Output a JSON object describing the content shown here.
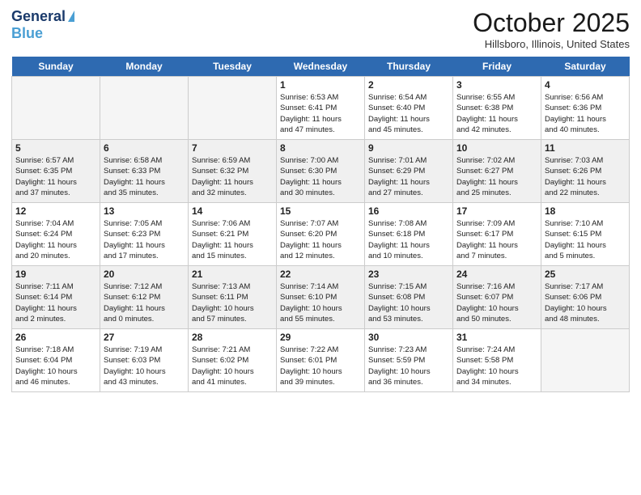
{
  "header": {
    "logo_line1": "General",
    "logo_line2": "Blue",
    "month": "October 2025",
    "location": "Hillsboro, Illinois, United States"
  },
  "days_of_week": [
    "Sunday",
    "Monday",
    "Tuesday",
    "Wednesday",
    "Thursday",
    "Friday",
    "Saturday"
  ],
  "weeks": [
    [
      {
        "day": "",
        "info": ""
      },
      {
        "day": "",
        "info": ""
      },
      {
        "day": "",
        "info": ""
      },
      {
        "day": "1",
        "info": "Sunrise: 6:53 AM\nSunset: 6:41 PM\nDaylight: 11 hours\nand 47 minutes."
      },
      {
        "day": "2",
        "info": "Sunrise: 6:54 AM\nSunset: 6:40 PM\nDaylight: 11 hours\nand 45 minutes."
      },
      {
        "day": "3",
        "info": "Sunrise: 6:55 AM\nSunset: 6:38 PM\nDaylight: 11 hours\nand 42 minutes."
      },
      {
        "day": "4",
        "info": "Sunrise: 6:56 AM\nSunset: 6:36 PM\nDaylight: 11 hours\nand 40 minutes."
      }
    ],
    [
      {
        "day": "5",
        "info": "Sunrise: 6:57 AM\nSunset: 6:35 PM\nDaylight: 11 hours\nand 37 minutes."
      },
      {
        "day": "6",
        "info": "Sunrise: 6:58 AM\nSunset: 6:33 PM\nDaylight: 11 hours\nand 35 minutes."
      },
      {
        "day": "7",
        "info": "Sunrise: 6:59 AM\nSunset: 6:32 PM\nDaylight: 11 hours\nand 32 minutes."
      },
      {
        "day": "8",
        "info": "Sunrise: 7:00 AM\nSunset: 6:30 PM\nDaylight: 11 hours\nand 30 minutes."
      },
      {
        "day": "9",
        "info": "Sunrise: 7:01 AM\nSunset: 6:29 PM\nDaylight: 11 hours\nand 27 minutes."
      },
      {
        "day": "10",
        "info": "Sunrise: 7:02 AM\nSunset: 6:27 PM\nDaylight: 11 hours\nand 25 minutes."
      },
      {
        "day": "11",
        "info": "Sunrise: 7:03 AM\nSunset: 6:26 PM\nDaylight: 11 hours\nand 22 minutes."
      }
    ],
    [
      {
        "day": "12",
        "info": "Sunrise: 7:04 AM\nSunset: 6:24 PM\nDaylight: 11 hours\nand 20 minutes."
      },
      {
        "day": "13",
        "info": "Sunrise: 7:05 AM\nSunset: 6:23 PM\nDaylight: 11 hours\nand 17 minutes."
      },
      {
        "day": "14",
        "info": "Sunrise: 7:06 AM\nSunset: 6:21 PM\nDaylight: 11 hours\nand 15 minutes."
      },
      {
        "day": "15",
        "info": "Sunrise: 7:07 AM\nSunset: 6:20 PM\nDaylight: 11 hours\nand 12 minutes."
      },
      {
        "day": "16",
        "info": "Sunrise: 7:08 AM\nSunset: 6:18 PM\nDaylight: 11 hours\nand 10 minutes."
      },
      {
        "day": "17",
        "info": "Sunrise: 7:09 AM\nSunset: 6:17 PM\nDaylight: 11 hours\nand 7 minutes."
      },
      {
        "day": "18",
        "info": "Sunrise: 7:10 AM\nSunset: 6:15 PM\nDaylight: 11 hours\nand 5 minutes."
      }
    ],
    [
      {
        "day": "19",
        "info": "Sunrise: 7:11 AM\nSunset: 6:14 PM\nDaylight: 11 hours\nand 2 minutes."
      },
      {
        "day": "20",
        "info": "Sunrise: 7:12 AM\nSunset: 6:12 PM\nDaylight: 11 hours\nand 0 minutes."
      },
      {
        "day": "21",
        "info": "Sunrise: 7:13 AM\nSunset: 6:11 PM\nDaylight: 10 hours\nand 57 minutes."
      },
      {
        "day": "22",
        "info": "Sunrise: 7:14 AM\nSunset: 6:10 PM\nDaylight: 10 hours\nand 55 minutes."
      },
      {
        "day": "23",
        "info": "Sunrise: 7:15 AM\nSunset: 6:08 PM\nDaylight: 10 hours\nand 53 minutes."
      },
      {
        "day": "24",
        "info": "Sunrise: 7:16 AM\nSunset: 6:07 PM\nDaylight: 10 hours\nand 50 minutes."
      },
      {
        "day": "25",
        "info": "Sunrise: 7:17 AM\nSunset: 6:06 PM\nDaylight: 10 hours\nand 48 minutes."
      }
    ],
    [
      {
        "day": "26",
        "info": "Sunrise: 7:18 AM\nSunset: 6:04 PM\nDaylight: 10 hours\nand 46 minutes."
      },
      {
        "day": "27",
        "info": "Sunrise: 7:19 AM\nSunset: 6:03 PM\nDaylight: 10 hours\nand 43 minutes."
      },
      {
        "day": "28",
        "info": "Sunrise: 7:21 AM\nSunset: 6:02 PM\nDaylight: 10 hours\nand 41 minutes."
      },
      {
        "day": "29",
        "info": "Sunrise: 7:22 AM\nSunset: 6:01 PM\nDaylight: 10 hours\nand 39 minutes."
      },
      {
        "day": "30",
        "info": "Sunrise: 7:23 AM\nSunset: 5:59 PM\nDaylight: 10 hours\nand 36 minutes."
      },
      {
        "day": "31",
        "info": "Sunrise: 7:24 AM\nSunset: 5:58 PM\nDaylight: 10 hours\nand 34 minutes."
      },
      {
        "day": "",
        "info": ""
      }
    ]
  ]
}
